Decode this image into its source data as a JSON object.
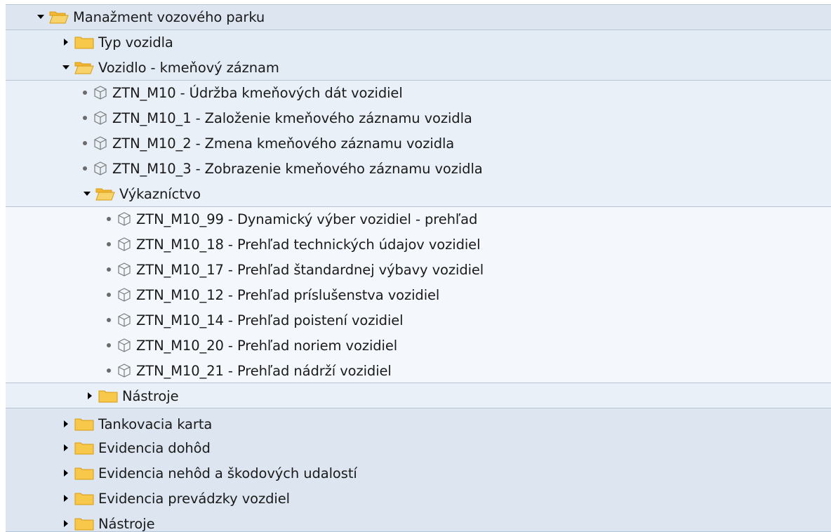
{
  "tree": {
    "root": {
      "label": "Manažment vozového parku",
      "children": {
        "typ": {
          "label": "Typ vozidla"
        },
        "vozidlo": {
          "label": "Vozidlo - kmeňový záznam",
          "items": [
            {
              "label": "ZTN_M10 - Údržba kmeňových dát vozidiel"
            },
            {
              "label": "ZTN_M10_1 - Založenie kmeňového záznamu vozidla"
            },
            {
              "label": "ZTN_M10_2 - Zmena kmeňového záznamu vozidla"
            },
            {
              "label": "ZTN_M10_3 - Zobrazenie kmeňového záznamu vozidla"
            }
          ],
          "vykaznictvo": {
            "label": "Výkazníctvo",
            "items": [
              {
                "label": "ZTN_M10_99 - Dynamický výber vozidiel - prehľad"
              },
              {
                "label": "ZTN_M10_18 - Prehľad technických údajov vozidiel"
              },
              {
                "label": "ZTN_M10_17 - Prehľad štandardnej výbavy vozidiel"
              },
              {
                "label": "ZTN_M10_12 - Prehľad príslušenstva vozidiel"
              },
              {
                "label": "ZTN_M10_14 - Prehľad poistení vozidiel"
              },
              {
                "label": "ZTN_M10_20 - Prehľad noriem vozidiel"
              },
              {
                "label": "ZTN_M10_21 - Prehľad nádrží vozidiel"
              }
            ]
          },
          "nastroje": {
            "label": "Nástroje"
          }
        },
        "tankovacia": {
          "label": "Tankovacia karta"
        },
        "dohody": {
          "label": "Evidencia dohôd"
        },
        "nehody": {
          "label": "Evidencia nehôd a škodových udalostí"
        },
        "prevadzka": {
          "label": "Evidencia prevádzky vozdiel"
        },
        "nastroje": {
          "label": "Nástroje"
        }
      }
    }
  },
  "colors": {
    "folder_fill": "#f7c84a",
    "folder_open_fill": "#f8d26a",
    "folder_stroke": "#d99a10",
    "band_border": "#b7c6d6",
    "text": "#1a1a1a"
  },
  "icons": {
    "expanded": "triangle-down-icon",
    "collapsed": "triangle-right-icon",
    "folder_closed": "folder-icon",
    "folder_open": "folder-open-icon",
    "transaction": "cube-icon"
  }
}
